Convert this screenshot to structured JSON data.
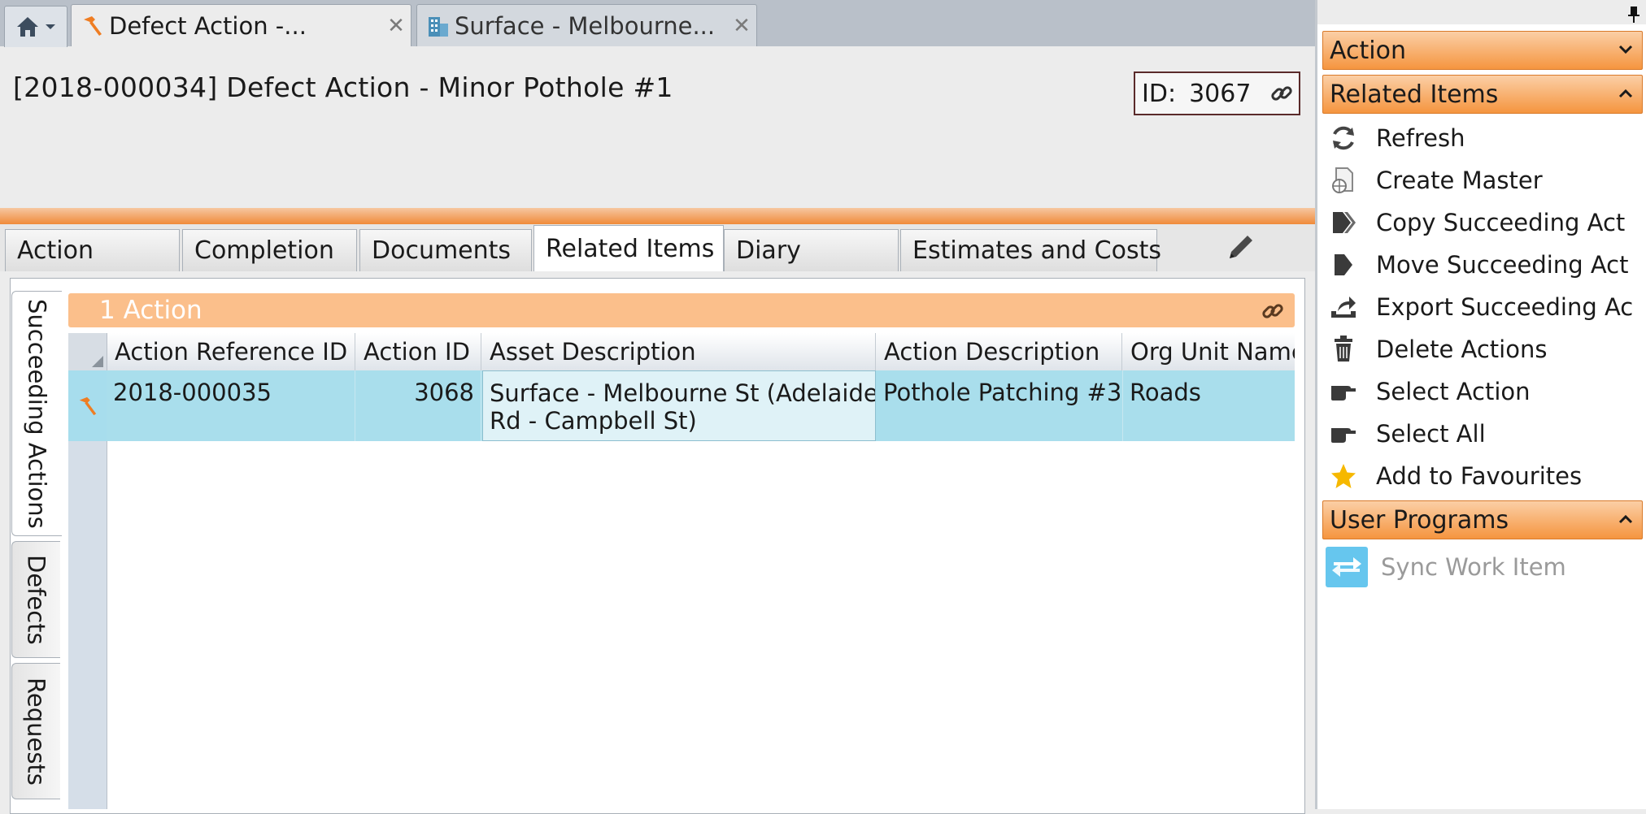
{
  "doc_tabs": [
    {
      "label": "Defect Action -...",
      "icon": "hammer-icon",
      "active": true
    },
    {
      "label": "Surface - Melbourne...",
      "icon": "building-icon",
      "active": false
    }
  ],
  "header": {
    "title": "[2018-000034] Defect Action - Minor Pothole #1",
    "id_label": "ID:",
    "id_value": "3067"
  },
  "section_tabs": [
    {
      "label": "Action"
    },
    {
      "label": "Completion"
    },
    {
      "label": "Documents"
    },
    {
      "label": "Related Items",
      "active": true
    },
    {
      "label": "Diary"
    },
    {
      "label": "Estimates and Costs"
    }
  ],
  "vertical_tabs": [
    {
      "label": "Succeeding Actions",
      "active": true
    },
    {
      "label": "Defects"
    },
    {
      "label": "Requests"
    }
  ],
  "grid": {
    "group_label": "1 Action",
    "columns": [
      "Action Reference ID",
      "Action ID",
      "Asset Description",
      "Action Description",
      "Org Unit Name"
    ],
    "rows": [
      {
        "action_reference_id": "2018-000035",
        "action_id": "3068",
        "asset_description_line1": "Surface - Melbourne St (Adelaide",
        "asset_description_line2": "Rd - Campbell St)",
        "action_description": "Pothole Patching #3",
        "org_unit_name": "Roads"
      }
    ]
  },
  "side_panel": {
    "sections": [
      {
        "label": "Action",
        "expanded": false
      },
      {
        "label": "Related Items",
        "expanded": true
      },
      {
        "label": "User Programs",
        "expanded": true
      }
    ],
    "related_items": [
      {
        "label": "Refresh",
        "icon": "refresh-icon"
      },
      {
        "label": "Create Master",
        "icon": "create-master-icon"
      },
      {
        "label": "Copy Succeeding Act",
        "icon": "copy-succeeding-icon"
      },
      {
        "label": "Move Succeeding Act",
        "icon": "move-succeeding-icon"
      },
      {
        "label": "Export Succeeding Ac",
        "icon": "export-icon"
      },
      {
        "label": "Delete Actions",
        "icon": "trash-icon"
      },
      {
        "label": "Select Action",
        "icon": "pointing-hand-icon"
      },
      {
        "label": "Select All",
        "icon": "pointing-hand-icon"
      },
      {
        "label": "Add to Favourites",
        "icon": "star-icon"
      }
    ],
    "user_programs": [
      {
        "label": "Sync Work Item",
        "icon": "sync-icon",
        "disabled": true
      }
    ]
  },
  "colors": {
    "accent_orange": "#f5953f",
    "group_bar": "#fbbf8b",
    "selected_row": "#a9deec",
    "star": "#f6b800"
  }
}
